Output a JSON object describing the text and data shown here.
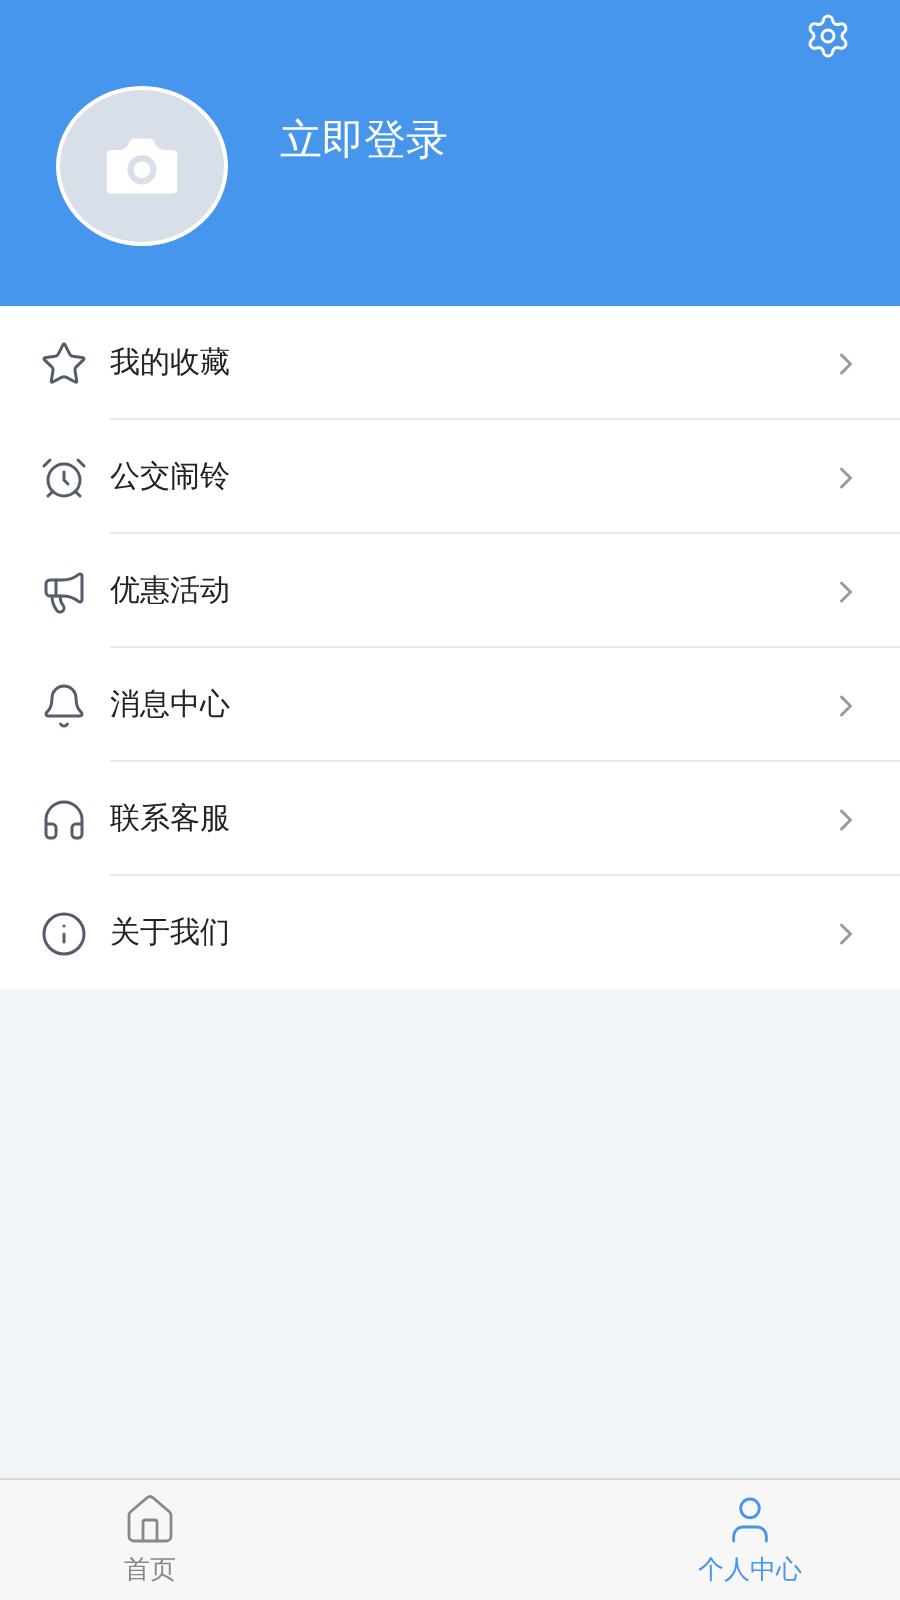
{
  "header": {
    "login_label": "立即登录"
  },
  "menu": [
    {
      "label": "我的收藏"
    },
    {
      "label": "公交闹铃"
    },
    {
      "label": "优惠活动"
    },
    {
      "label": "消息中心"
    },
    {
      "label": "联系客服"
    },
    {
      "label": "关于我们"
    }
  ],
  "tab_bar": [
    {
      "label": "首页",
      "selected": false
    },
    {
      "label": "个人中心",
      "selected": true
    }
  ]
}
